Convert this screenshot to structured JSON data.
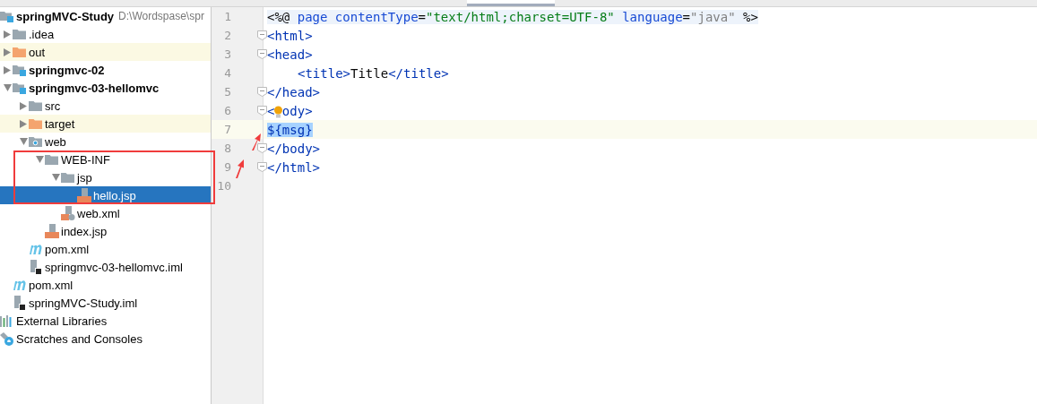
{
  "project_tree": [
    {
      "label": "springMVC-Study",
      "kind": "module",
      "path": "D:\\Wordspase\\spr",
      "selected": false,
      "excluded": false,
      "children": [
        {
          "label": ".idea",
          "kind": "folder",
          "expanded": false,
          "selected": false,
          "excluded": false
        },
        {
          "label": "out",
          "kind": "folder",
          "expanded": false,
          "selected": false,
          "excluded": true
        },
        {
          "label": "springmvc-02",
          "kind": "module",
          "expanded": false,
          "selected": false,
          "excluded": false
        },
        {
          "label": "springmvc-03-hellomvc",
          "kind": "module",
          "expanded": true,
          "selected": false,
          "excluded": false,
          "children": [
            {
              "label": "src",
              "kind": "folder",
              "expanded": false,
              "selected": false,
              "excluded": false
            },
            {
              "label": "target",
              "kind": "folder",
              "expanded": false,
              "selected": false,
              "excluded": true
            },
            {
              "label": "web",
              "kind": "web",
              "expanded": true,
              "selected": false,
              "excluded": false,
              "children": [
                {
                  "label": "WEB-INF",
                  "kind": "folder",
                  "expanded": true,
                  "selected": false,
                  "excluded": false,
                  "children": [
                    {
                      "label": "jsp",
                      "kind": "folder",
                      "expanded": true,
                      "selected": false,
                      "excluded": false,
                      "children": [
                        {
                          "label": "hello.jsp",
                          "kind": "jsp",
                          "selected": true,
                          "excluded": false
                        }
                      ]
                    },
                    {
                      "label": "web.xml",
                      "kind": "xml",
                      "selected": false,
                      "excluded": false
                    }
                  ]
                },
                {
                  "label": "index.jsp",
                  "kind": "jsp",
                  "selected": false,
                  "excluded": false
                }
              ]
            },
            {
              "label": "pom.xml",
              "kind": "maven",
              "selected": false,
              "excluded": false
            },
            {
              "label": "springmvc-03-hellomvc.iml",
              "kind": "iml",
              "selected": false,
              "excluded": false
            }
          ]
        },
        {
          "label": "pom.xml",
          "kind": "maven",
          "selected": false,
          "excluded": false
        },
        {
          "label": "springMVC-Study.iml",
          "kind": "iml",
          "selected": false,
          "excluded": false
        }
      ]
    },
    {
      "label": "External Libraries",
      "kind": "libraries",
      "selected": false,
      "excluded": false
    },
    {
      "label": "Scratches and Consoles",
      "kind": "scratches",
      "selected": false,
      "excluded": false
    }
  ],
  "editor": {
    "lines": [
      {
        "number": "1",
        "kind": "directive",
        "current": false,
        "fold": false,
        "indent": false,
        "tokens": [
          {
            "text": "<%@ ",
            "kind": "plain"
          },
          {
            "text": "page contentType",
            "kind": "attr"
          },
          {
            "text": "=",
            "kind": "plain"
          },
          {
            "text": "\"text/html;charset=UTF-8\" ",
            "kind": "string"
          },
          {
            "text": "language",
            "kind": "attr"
          },
          {
            "text": "=",
            "kind": "plain"
          },
          {
            "text": "\"java\"",
            "kind": "value"
          },
          {
            "text": " %>",
            "kind": "plain"
          }
        ]
      },
      {
        "number": "2",
        "kind": "markup",
        "current": false,
        "fold": true,
        "indent": false,
        "tokens": [
          {
            "text": "<html>",
            "kind": "tag"
          }
        ]
      },
      {
        "number": "3",
        "kind": "markup",
        "current": false,
        "fold": true,
        "indent": false,
        "tokens": [
          {
            "text": "<head>",
            "kind": "tag"
          }
        ]
      },
      {
        "number": "4",
        "kind": "markup",
        "current": false,
        "fold": false,
        "indent": true,
        "tokens": [
          {
            "text": "<title>",
            "kind": "tag"
          },
          {
            "text": "Title",
            "kind": "plain"
          },
          {
            "text": "</title>",
            "kind": "tag"
          }
        ]
      },
      {
        "number": "5",
        "kind": "markup",
        "current": false,
        "fold": true,
        "indent": false,
        "tokens": [
          {
            "text": "</head>",
            "kind": "tag"
          }
        ]
      },
      {
        "number": "6",
        "kind": "markup",
        "current": false,
        "fold": true,
        "indent": false,
        "tokens": [
          {
            "text": "<",
            "kind": "tag"
          },
          {
            "kind": "bulb"
          },
          {
            "text": "ody>",
            "kind": "tag"
          }
        ]
      },
      {
        "number": "7",
        "kind": "markup",
        "current": true,
        "fold": false,
        "indent": false,
        "tokens": [
          {
            "text": "${msg}",
            "kind": "selection"
          }
        ]
      },
      {
        "number": "8",
        "kind": "markup",
        "current": false,
        "fold": true,
        "indent": false,
        "tokens": [
          {
            "text": "</body>",
            "kind": "tag"
          }
        ]
      },
      {
        "number": "9",
        "kind": "markup",
        "current": false,
        "fold": true,
        "indent": false,
        "tokens": [
          {
            "text": "</html>",
            "kind": "tag"
          }
        ]
      },
      {
        "number": "10",
        "kind": "markup",
        "current": false,
        "fold": false
      }
    ]
  }
}
